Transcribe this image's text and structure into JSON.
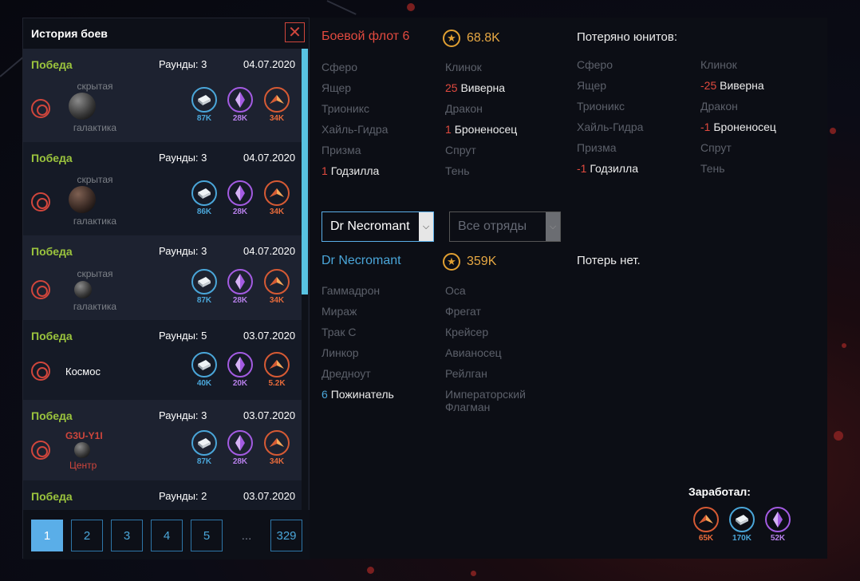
{
  "panel": {
    "title": "История боев",
    "close_icon": "close-icon"
  },
  "battles": [
    {
      "result": "Победа",
      "rounds": "Раунды: 3",
      "date": "04.07.2020",
      "loc1": "скрытая",
      "loc2": "галактика",
      "metal": "87K",
      "crystal": "28K",
      "deut": "34K"
    },
    {
      "result": "Победа",
      "rounds": "Раунды: 3",
      "date": "04.07.2020",
      "loc1": "скрытая",
      "loc2": "галактика",
      "metal": "86K",
      "crystal": "28K",
      "deut": "34K"
    },
    {
      "result": "Победа",
      "rounds": "Раунды: 3",
      "date": "04.07.2020",
      "loc1": "скрытая",
      "loc2": "галактика",
      "metal": "87K",
      "crystal": "28K",
      "deut": "34K"
    },
    {
      "result": "Победа",
      "rounds": "Раунды: 5",
      "date": "03.07.2020",
      "loc1": "Космос",
      "metal": "40K",
      "crystal": "20K",
      "deut": "5.2K"
    },
    {
      "result": "Победа",
      "rounds": "Раунды: 3",
      "date": "03.07.2020",
      "loc1": "G3U-Y1I",
      "loc2": "Центр",
      "metal": "87K",
      "crystal": "28K",
      "deut": "34K"
    },
    {
      "result": "Победа",
      "rounds": "Раунды: 2",
      "date": "03.07.2020"
    }
  ],
  "pagination": {
    "pages": [
      "1",
      "2",
      "3",
      "4",
      "5",
      "...",
      "329"
    ],
    "current": "1"
  },
  "enemy": {
    "name": "Боевой флот 6",
    "power": "68.8K",
    "col1": [
      {
        "name": "Сферо"
      },
      {
        "name": "Ящер"
      },
      {
        "name": "Трионикс"
      },
      {
        "name": "Хайль-Гидра"
      },
      {
        "name": "Призма"
      },
      {
        "num": "1",
        "name": "Годзилла"
      }
    ],
    "col2": [
      {
        "name": "Клинок"
      },
      {
        "num": "25",
        "name": "Виверна"
      },
      {
        "name": "Дракон"
      },
      {
        "num": "1",
        "name": "Броненосец"
      },
      {
        "name": "Спрут"
      },
      {
        "name": "Тень"
      }
    ]
  },
  "lost": {
    "title": "Потеряно юнитов:",
    "col1": [
      {
        "name": "Сферо"
      },
      {
        "name": "Ящер"
      },
      {
        "name": "Трионикс"
      },
      {
        "name": "Хайль-Гидра"
      },
      {
        "name": "Призма"
      },
      {
        "num": "-1",
        "name": "Годзилла"
      }
    ],
    "col2": [
      {
        "name": "Клинок"
      },
      {
        "num": "-25",
        "name": "Виверна"
      },
      {
        "name": "Дракон"
      },
      {
        "num": "-1",
        "name": "Броненосец"
      },
      {
        "name": "Спрут"
      },
      {
        "name": "Тень"
      }
    ]
  },
  "filters": {
    "player": "Dr Necromant",
    "squads": "Все отряды"
  },
  "player": {
    "name": "Dr Necromant",
    "power": "359K",
    "losses": "Потерь нет.",
    "col1": [
      {
        "name": "Гаммадрон"
      },
      {
        "name": "Мираж"
      },
      {
        "name": "Трак С"
      },
      {
        "name": "Линкор"
      },
      {
        "name": "Дредноут"
      },
      {
        "num": "6",
        "name": "Пожинатель"
      }
    ],
    "col2": [
      {
        "name": "Оса"
      },
      {
        "name": "Фрегат"
      },
      {
        "name": "Крейсер"
      },
      {
        "name": "Авианосец"
      },
      {
        "name": "Рейлган"
      },
      {
        "name": "Императорский Флагман"
      }
    ]
  },
  "earned": {
    "label": "Заработал:",
    "deut": "65K",
    "metal": "170K",
    "crystal": "52K"
  },
  "colors": {
    "accent_blue": "#4aa6d9",
    "victory_green": "#9bc43d",
    "enemy_red": "#e24a3f",
    "gold": "#e1a032"
  }
}
